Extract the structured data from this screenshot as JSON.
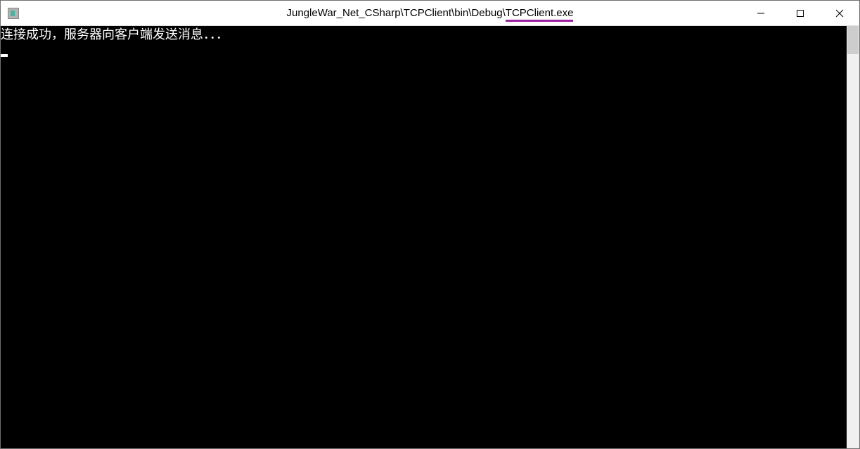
{
  "window": {
    "title_prefix": "JungleWar_Net_CSharp\\TCPClient\\bin\\Debug\\",
    "title_highlighted": "TCPClient.exe"
  },
  "console": {
    "line1": "连接成功，服务器向客户端发送消息．．．"
  }
}
